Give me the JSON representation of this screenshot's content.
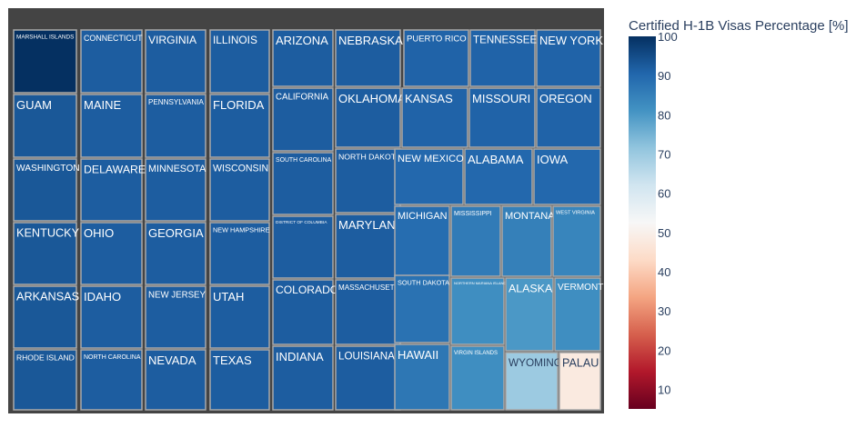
{
  "chart_data": {
    "type": "treemap",
    "title": "",
    "colorbar": {
      "title": "Certified H-1B Visas Percentage [%]",
      "range": [
        5,
        100
      ],
      "ticks": [
        10,
        20,
        30,
        40,
        50,
        60,
        70,
        80,
        90,
        100
      ],
      "colorscale": "RdBu"
    },
    "labels": [
      "MARSHALL ISLANDS",
      "GUAM",
      "WASHINGTON",
      "KENTUCKY",
      "ARKANSAS",
      "RHODE ISLAND",
      "CONNECTICUT",
      "MAINE",
      "DELAWARE",
      "OHIO",
      "IDAHO",
      "NORTH CAROLINA",
      "VIRGINIA",
      "PENNSYLVANIA",
      "MINNESOTA",
      "GEORGIA",
      "NEW JERSEY",
      "NEVADA",
      "ILLINOIS",
      "FLORIDA",
      "WISCONSIN",
      "NEW HAMPSHIRE",
      "UTAH",
      "TEXAS",
      "ARIZONA",
      "CALIFORNIA",
      "SOUTH CAROLINA",
      "DISTRICT OF COLUMBIA",
      "COLORADO",
      "INDIANA",
      "NEBRASKA",
      "OKLAHOMA",
      "NORTH DAKOTA",
      "MARYLAND",
      "MASSACHUSETTS",
      "LOUISIANA",
      "PUERTO RICO",
      "TENNESSEE",
      "NEW YORK",
      "KANSAS",
      "MISSOURI",
      "OREGON",
      "NEW MEXICO",
      "ALABAMA",
      "IOWA",
      "MICHIGAN",
      "MISSISSIPPI",
      "MONTANA",
      "WEST VIRGINIA",
      "SOUTH DAKOTA",
      "NORTHERN MARIANA ISLANDS",
      "ALASKA",
      "VERMONT",
      "HAWAII",
      "VIRGIN ISLANDS",
      "WYOMING",
      "PALAU"
    ],
    "values_pct": [
      100,
      93,
      93,
      93,
      93,
      93,
      92,
      92,
      92,
      92,
      92,
      92,
      92,
      92,
      92,
      92,
      92,
      92,
      92,
      92,
      92,
      92,
      92,
      92,
      92,
      92,
      92,
      92,
      92,
      92,
      92,
      92,
      92,
      92,
      92,
      92,
      91,
      91,
      91,
      91,
      91,
      91,
      90,
      90,
      90,
      89,
      86,
      85,
      84,
      88,
      82,
      80,
      82,
      87,
      82,
      70,
      48
    ],
    "colorscale_stops": [
      [
        0.0,
        "#67001f"
      ],
      [
        0.1,
        "#b2182b"
      ],
      [
        0.2,
        "#d6604d"
      ],
      [
        0.3,
        "#f4a582"
      ],
      [
        0.4,
        "#fddbc7"
      ],
      [
        0.5,
        "#f7f7f7"
      ],
      [
        0.6,
        "#d1e5f0"
      ],
      [
        0.7,
        "#92c5de"
      ],
      [
        0.8,
        "#4393c3"
      ],
      [
        0.9,
        "#2166ac"
      ],
      [
        1.0,
        "#053061"
      ]
    ]
  }
}
